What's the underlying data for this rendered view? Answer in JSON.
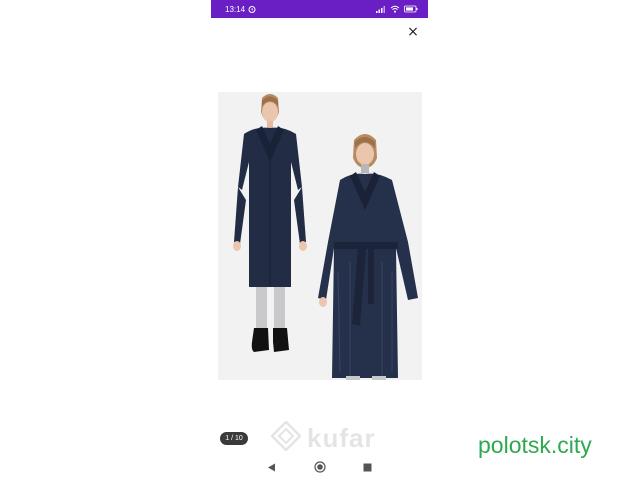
{
  "status_bar": {
    "time": "13:14",
    "background_color": "#6a1fc4",
    "icons": [
      "alarm-icon",
      "signal-icon",
      "wifi-icon",
      "battery-icon"
    ]
  },
  "viewer": {
    "close_symbol": "×",
    "page_indicator": "1 / 10",
    "watermark": "kufar"
  },
  "nav_bar": {
    "icons": [
      "back-icon",
      "home-icon",
      "recents-icon"
    ]
  },
  "site_label": {
    "text": "polotsk.city",
    "color": "#2fa84f"
  }
}
